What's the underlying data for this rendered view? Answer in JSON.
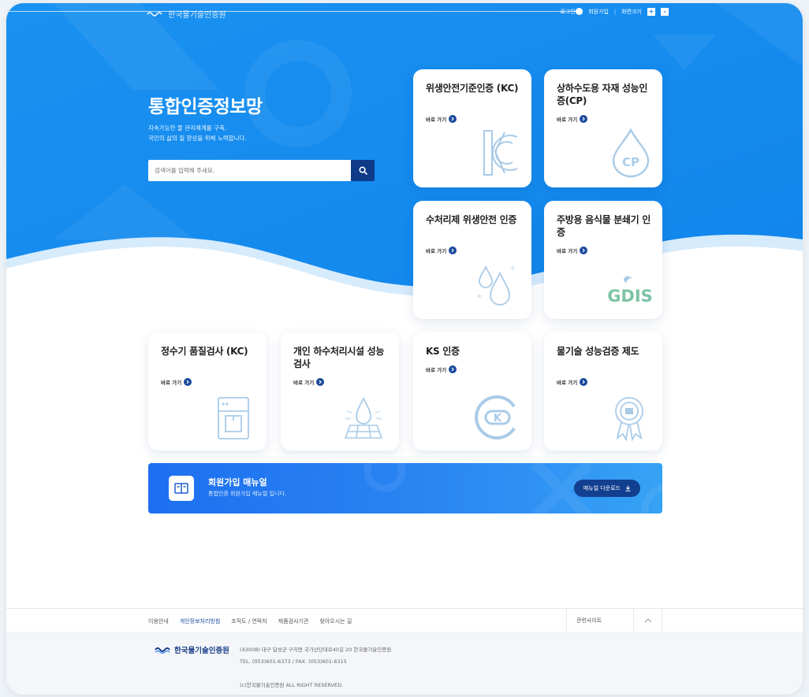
{
  "header": {
    "org_name": "한국물기술인증원",
    "login": "로그인",
    "join": "회원가입",
    "zoom_label": "화면크기",
    "zoom_in": "+",
    "zoom_out": "-"
  },
  "hero": {
    "title": "통합인증정보망",
    "desc_line1": "지속가능한 물 관리체계를 구축,",
    "desc_line2": "국민의 삶의 질 향상을 위해 노력합니다.",
    "search_placeholder": "검색어를 입력해 주세요."
  },
  "link_label": "바로 가기",
  "cards": [
    {
      "title": "위생안전기준인증 (KC)",
      "icon": "kc-mark-icon"
    },
    {
      "title": "상하수도용 자재 성능인증(CP)",
      "icon": "cp-mark-icon"
    },
    {
      "title": "수처리제 위생안전 인증",
      "icon": "water-drops-icon"
    },
    {
      "title": "주방용 음식물 분쇄기 인증",
      "icon": "gdis-logo-icon",
      "icon_text": "GDIS"
    },
    {
      "title": "정수기 품질검사 (KC)",
      "icon": "water-purifier-icon"
    },
    {
      "title": "개인 하수처리시설 성능검사",
      "icon": "sewage-facility-icon"
    },
    {
      "title": "KS 인증",
      "icon": "ks-mark-icon"
    },
    {
      "title": "물기술 성능검증 제도",
      "icon": "award-badge-icon"
    }
  ],
  "banner": {
    "title": "회원가입 매뉴얼",
    "subtitle": "통합인증 회원가입 매뉴얼 입니다.",
    "button": "매뉴얼 다운로드"
  },
  "footer": {
    "links": [
      "이용안내",
      "개인정보처리방침",
      "조직도 / 연락처",
      "제품검사기관",
      "찾아오시는 길"
    ],
    "family_site": "관련사이트",
    "org_name": "한국물기술인증원",
    "address": "(43008) 대구 달성군 구지면 국가산단대로40길 20 한국물기술인증원",
    "tel": "TEL. (053)601-6373 / FAX. (053)601-6315",
    "copyright": "(c)한국물기술인증원 ALL RIGHT RESERVED."
  },
  "colors": {
    "hero_blue": "#1a8ef0",
    "navy": "#1a4a9c",
    "banner_blue": "#2a86f2"
  }
}
